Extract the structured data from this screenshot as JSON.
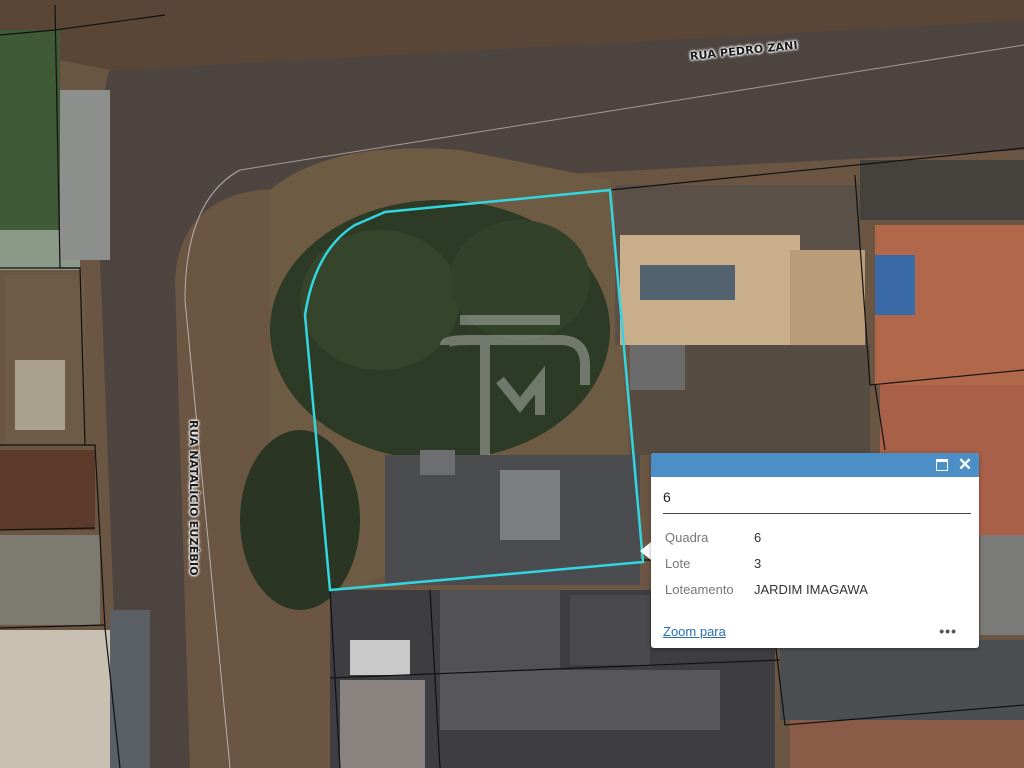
{
  "map": {
    "streets": {
      "top": "RUA PEDRO ZANI",
      "left": "RUA NATALÍCIO EUZÉBIO"
    },
    "colors": {
      "selection": "#33d6e0",
      "parcel_lines": "#111111",
      "popup_header": "#4c8fc6"
    },
    "watermark": "MT"
  },
  "popup": {
    "title": "6",
    "maximize_icon": "maximize-icon",
    "close_glyph": "✕",
    "fields": [
      {
        "label": "Quadra",
        "value": "6"
      },
      {
        "label": "Lote",
        "value": "3"
      },
      {
        "label": "Loteamento",
        "value": "JARDIM IMAGAWA"
      }
    ],
    "zoom_label": "Zoom para",
    "more_glyph": "•••"
  }
}
